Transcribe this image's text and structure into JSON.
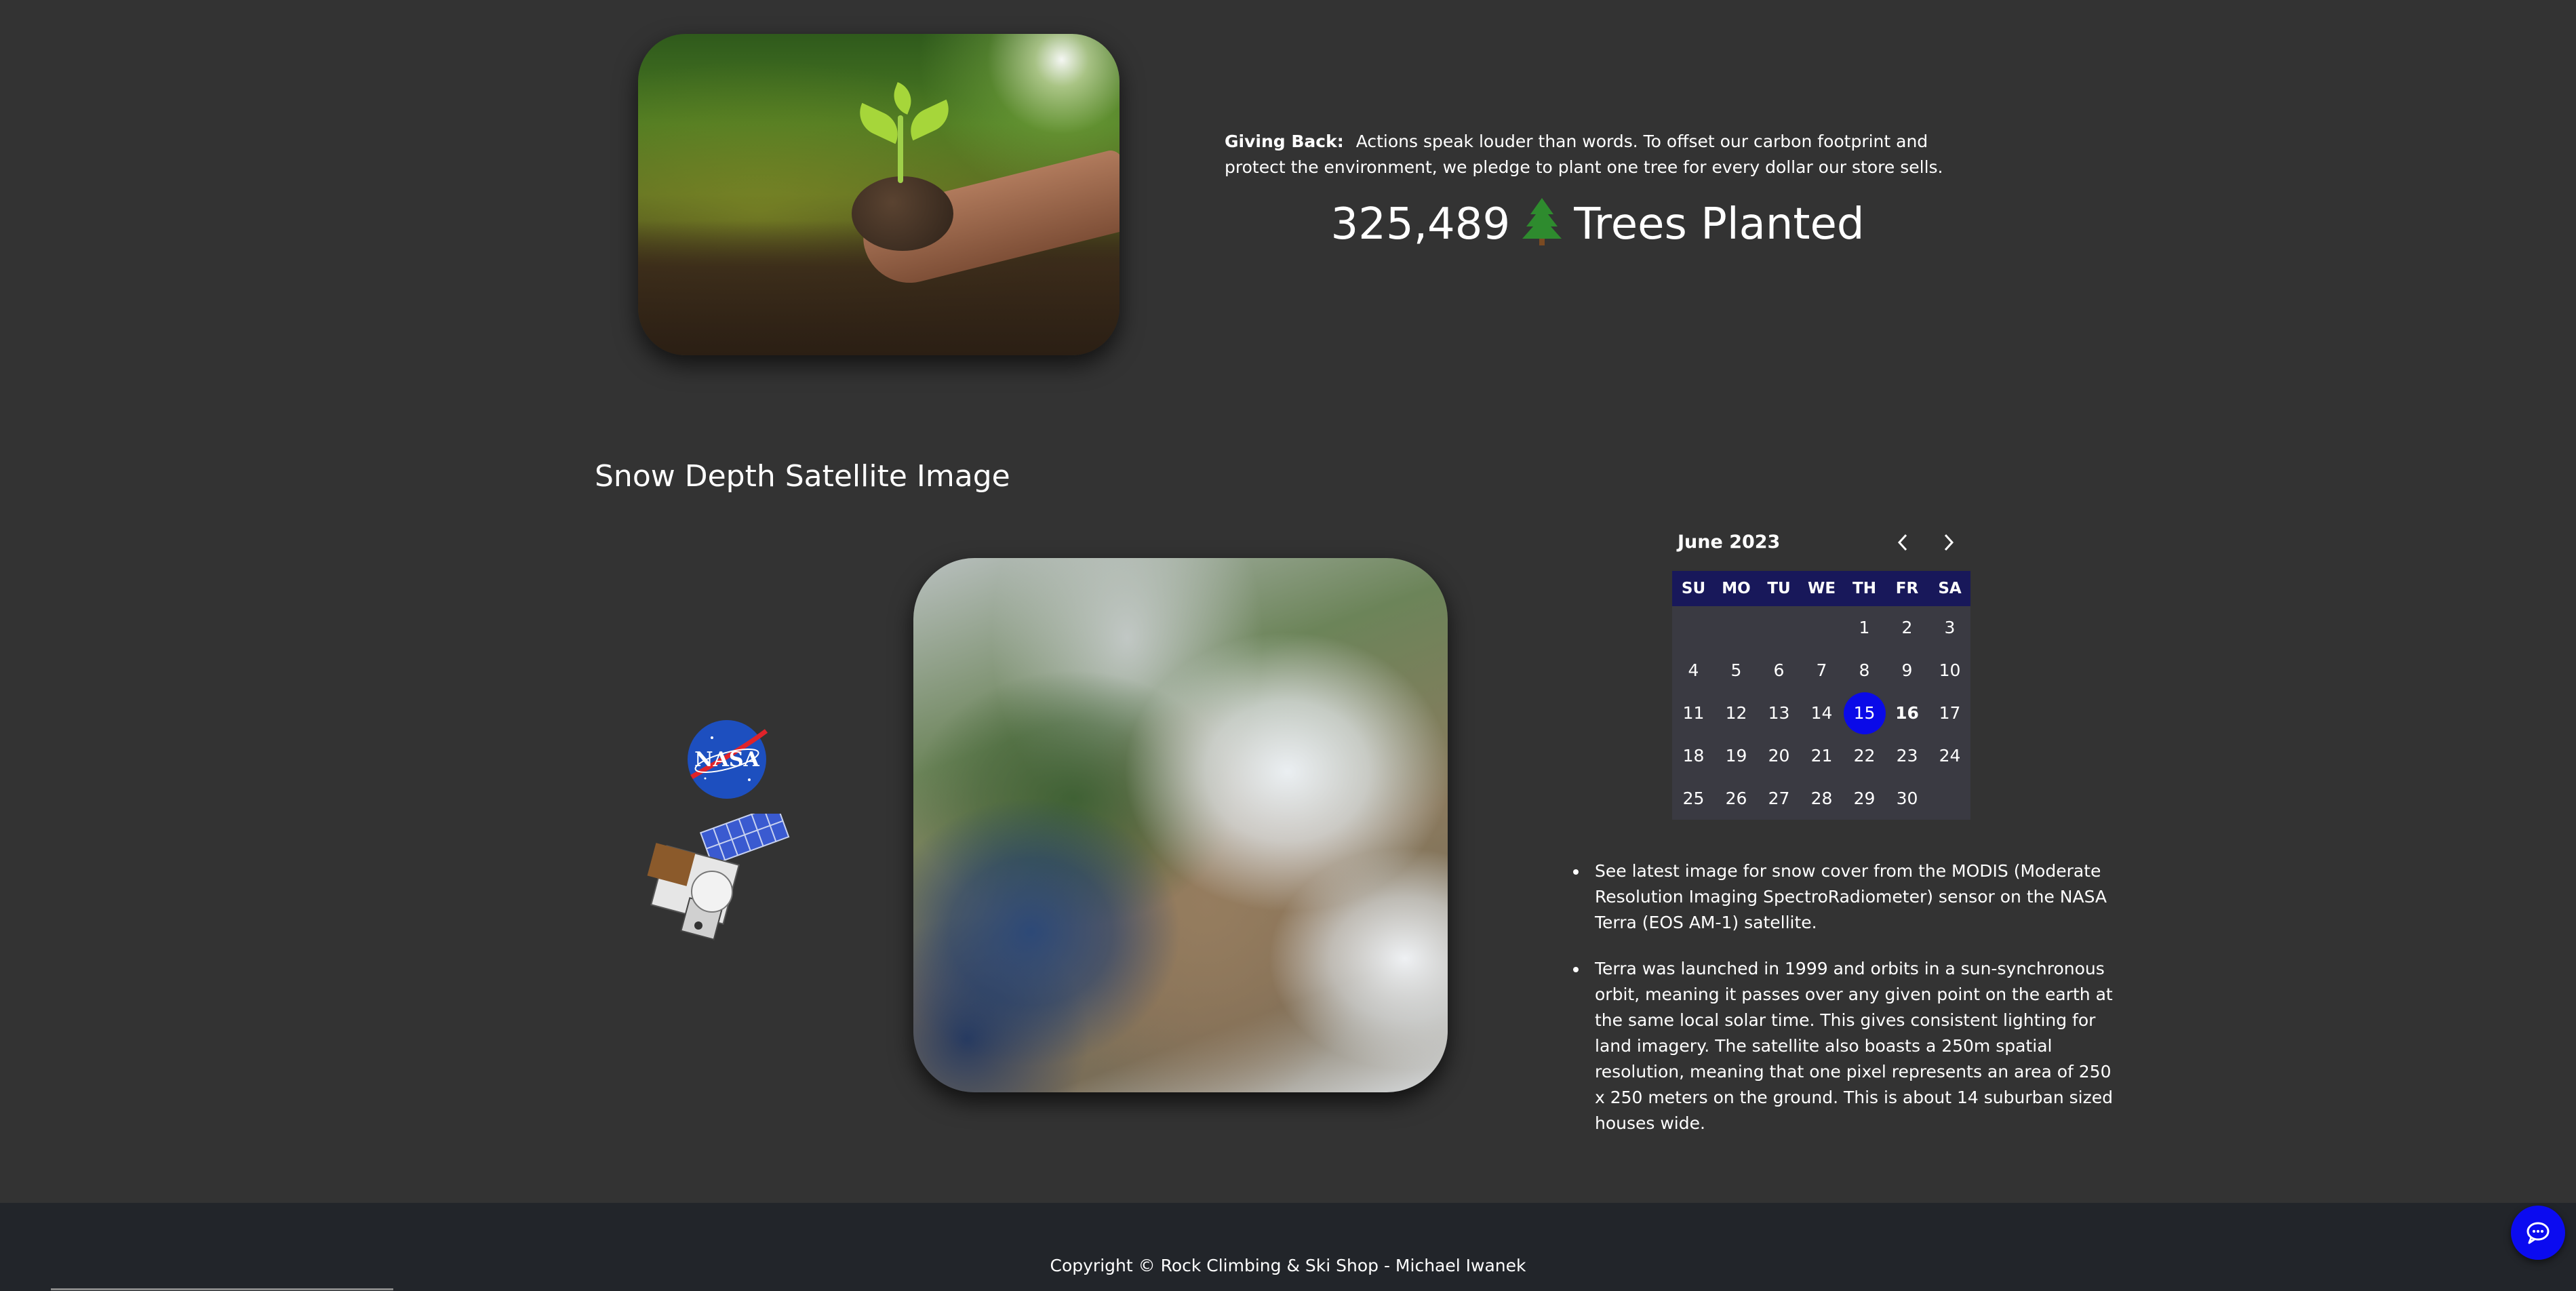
{
  "giving_back": {
    "label": "Giving Back:",
    "text": "Actions speak louder than words. To offset our carbon footprint and protect the environment, we pledge to plant one tree for every dollar our store sells.",
    "trees_count": "325,489",
    "trees_label": "Trees Planted",
    "tree_icon": "evergreen-tree-icon"
  },
  "snow_section": {
    "title": "Snow Depth Satellite Image"
  },
  "calendar": {
    "month_label": "June 2023",
    "prev_icon": "chevron-left-icon",
    "next_icon": "chevron-right-icon",
    "weekdays": [
      "SU",
      "MO",
      "TU",
      "WE",
      "TH",
      "FR",
      "SA"
    ],
    "weeks": [
      [
        "",
        "",
        "",
        "",
        "1",
        "2",
        "3"
      ],
      [
        "4",
        "5",
        "6",
        "7",
        "8",
        "9",
        "10"
      ],
      [
        "11",
        "12",
        "13",
        "14",
        "15",
        "16",
        "17"
      ],
      [
        "18",
        "19",
        "20",
        "21",
        "22",
        "23",
        "24"
      ],
      [
        "25",
        "26",
        "27",
        "28",
        "29",
        "30",
        ""
      ]
    ],
    "selected_day": "15",
    "today": "16",
    "selected_color": "#0a0ae8",
    "header_color": "#18185a"
  },
  "info": {
    "bullets": [
      "See latest image for snow cover from the MODIS (Moderate Resolution Imaging SpectroRadiometer) sensor on the NASA Terra (EOS AM-1) satellite.",
      "Terra was launched in 1999 and orbits in a sun-synchronous orbit, meaning it passes over any given point on the earth at the same local solar time. This gives consistent lighting for land imagery. The satellite also boasts a 250m spatial resolution, meaning that one pixel represents an area of 250 x 250 meters on the ground. This is about 14 suburban sized houses wide."
    ]
  },
  "footer": {
    "copyright": "Copyright © Rock Climbing & Ski Shop - Michael Iwanek",
    "chat_icon": "chat-bubble-icon"
  },
  "colors": {
    "background": "#333333",
    "footer": "#22252a",
    "accent": "#0b0bf0"
  }
}
